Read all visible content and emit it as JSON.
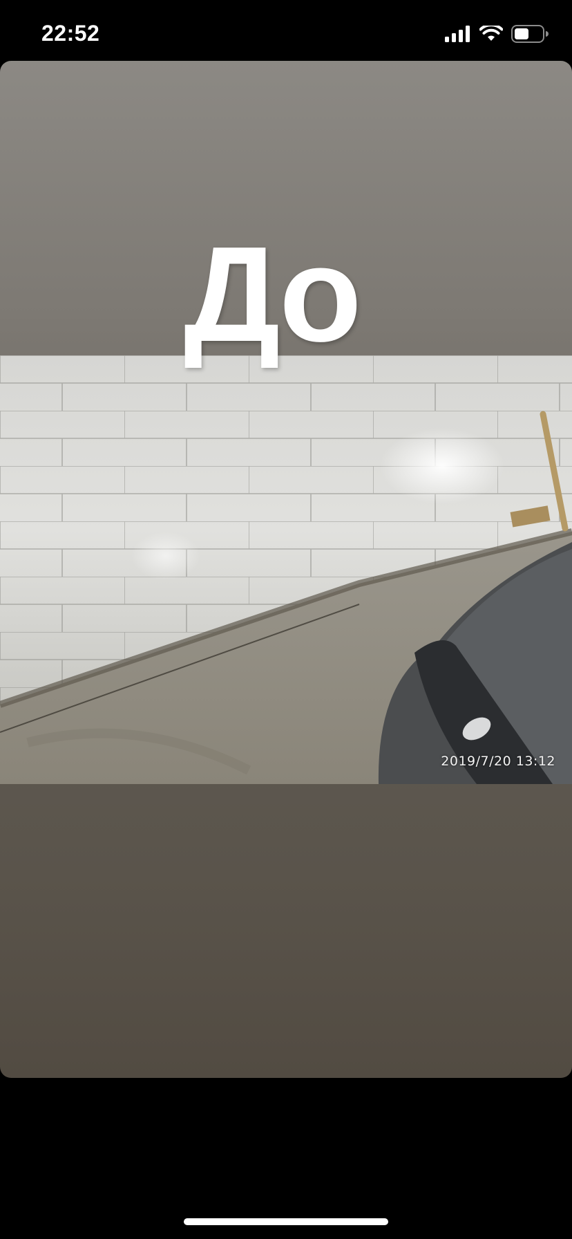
{
  "status_bar": {
    "time": "22:52",
    "icons": [
      "cellular-signal-icon",
      "wifi-icon",
      "battery-icon"
    ]
  },
  "story": {
    "caption": "До",
    "photo_timestamp": "2019/7/20  13:12"
  }
}
